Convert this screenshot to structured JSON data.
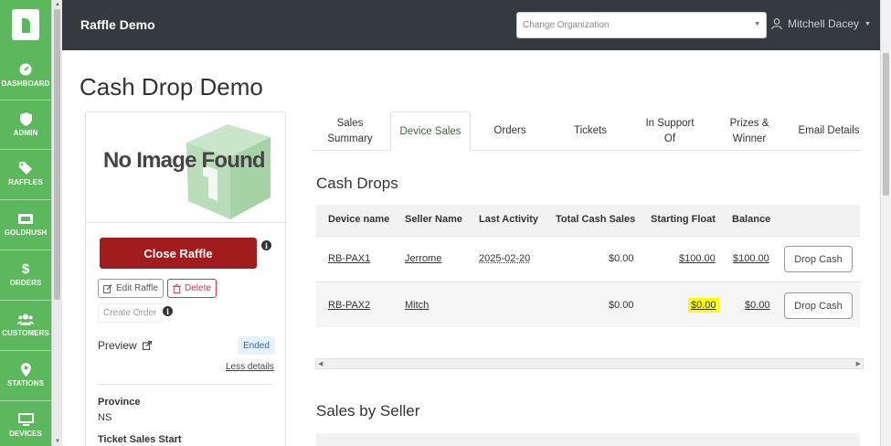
{
  "app": {
    "title": "Raffle Demo"
  },
  "org_select": {
    "placeholder": "Change Organization"
  },
  "user": {
    "name": "Mitchell Dacey"
  },
  "sidebar": {
    "items": [
      {
        "label": "DASHBOARD",
        "icon": "gauge-icon"
      },
      {
        "label": "ADMIN",
        "icon": "shield-icon"
      },
      {
        "label": "RAFFLES",
        "icon": "tag-icon"
      },
      {
        "label": "GOLDRUSH",
        "icon": "ticket-icon"
      },
      {
        "label": "ORDERS",
        "icon": "dollar-icon"
      },
      {
        "label": "CUSTOMERS",
        "icon": "users-icon"
      },
      {
        "label": "STATIONS",
        "icon": "map-pin-icon"
      },
      {
        "label": "DEVICES",
        "icon": "monitor-icon"
      }
    ]
  },
  "page": {
    "title": "Cash Drop Demo"
  },
  "card": {
    "no_image": "No Image Found",
    "close_raffle": "Close Raffle",
    "edit_raffle": "Edit Raffle",
    "delete": "Delete",
    "create_order": "Create Order",
    "preview": "Preview",
    "status": "Ended",
    "less_details": "Less details",
    "province_label": "Province",
    "province_value": "NS",
    "ticket_sales_start_label": "Ticket Sales Start"
  },
  "tabs": [
    {
      "label": "Sales Summary"
    },
    {
      "label": "Device Sales"
    },
    {
      "label": "Orders"
    },
    {
      "label": "Tickets"
    },
    {
      "label": "In Support Of"
    },
    {
      "label": "Prizes & Winner"
    },
    {
      "label": "Email Details"
    }
  ],
  "cash_drops": {
    "title": "Cash Drops",
    "columns": [
      "Device name",
      "Seller Name",
      "Last Activity",
      "Total Cash Sales",
      "Starting Float",
      "Balance"
    ],
    "rows": [
      {
        "device": "RB-PAX1",
        "seller": "Jerrome",
        "last_activity": "2025-02-20",
        "total_cash": "$0.00",
        "starting_float": "$100.00",
        "balance": "$100.00",
        "action": "Drop Cash"
      },
      {
        "device": "RB-PAX2",
        "seller": "Mitch",
        "last_activity": "",
        "total_cash": "$0.00",
        "starting_float": "$0.00",
        "balance": "$0.00",
        "action": "Drop Cash"
      }
    ]
  },
  "sales_by_seller": {
    "title": "Sales by Seller"
  }
}
